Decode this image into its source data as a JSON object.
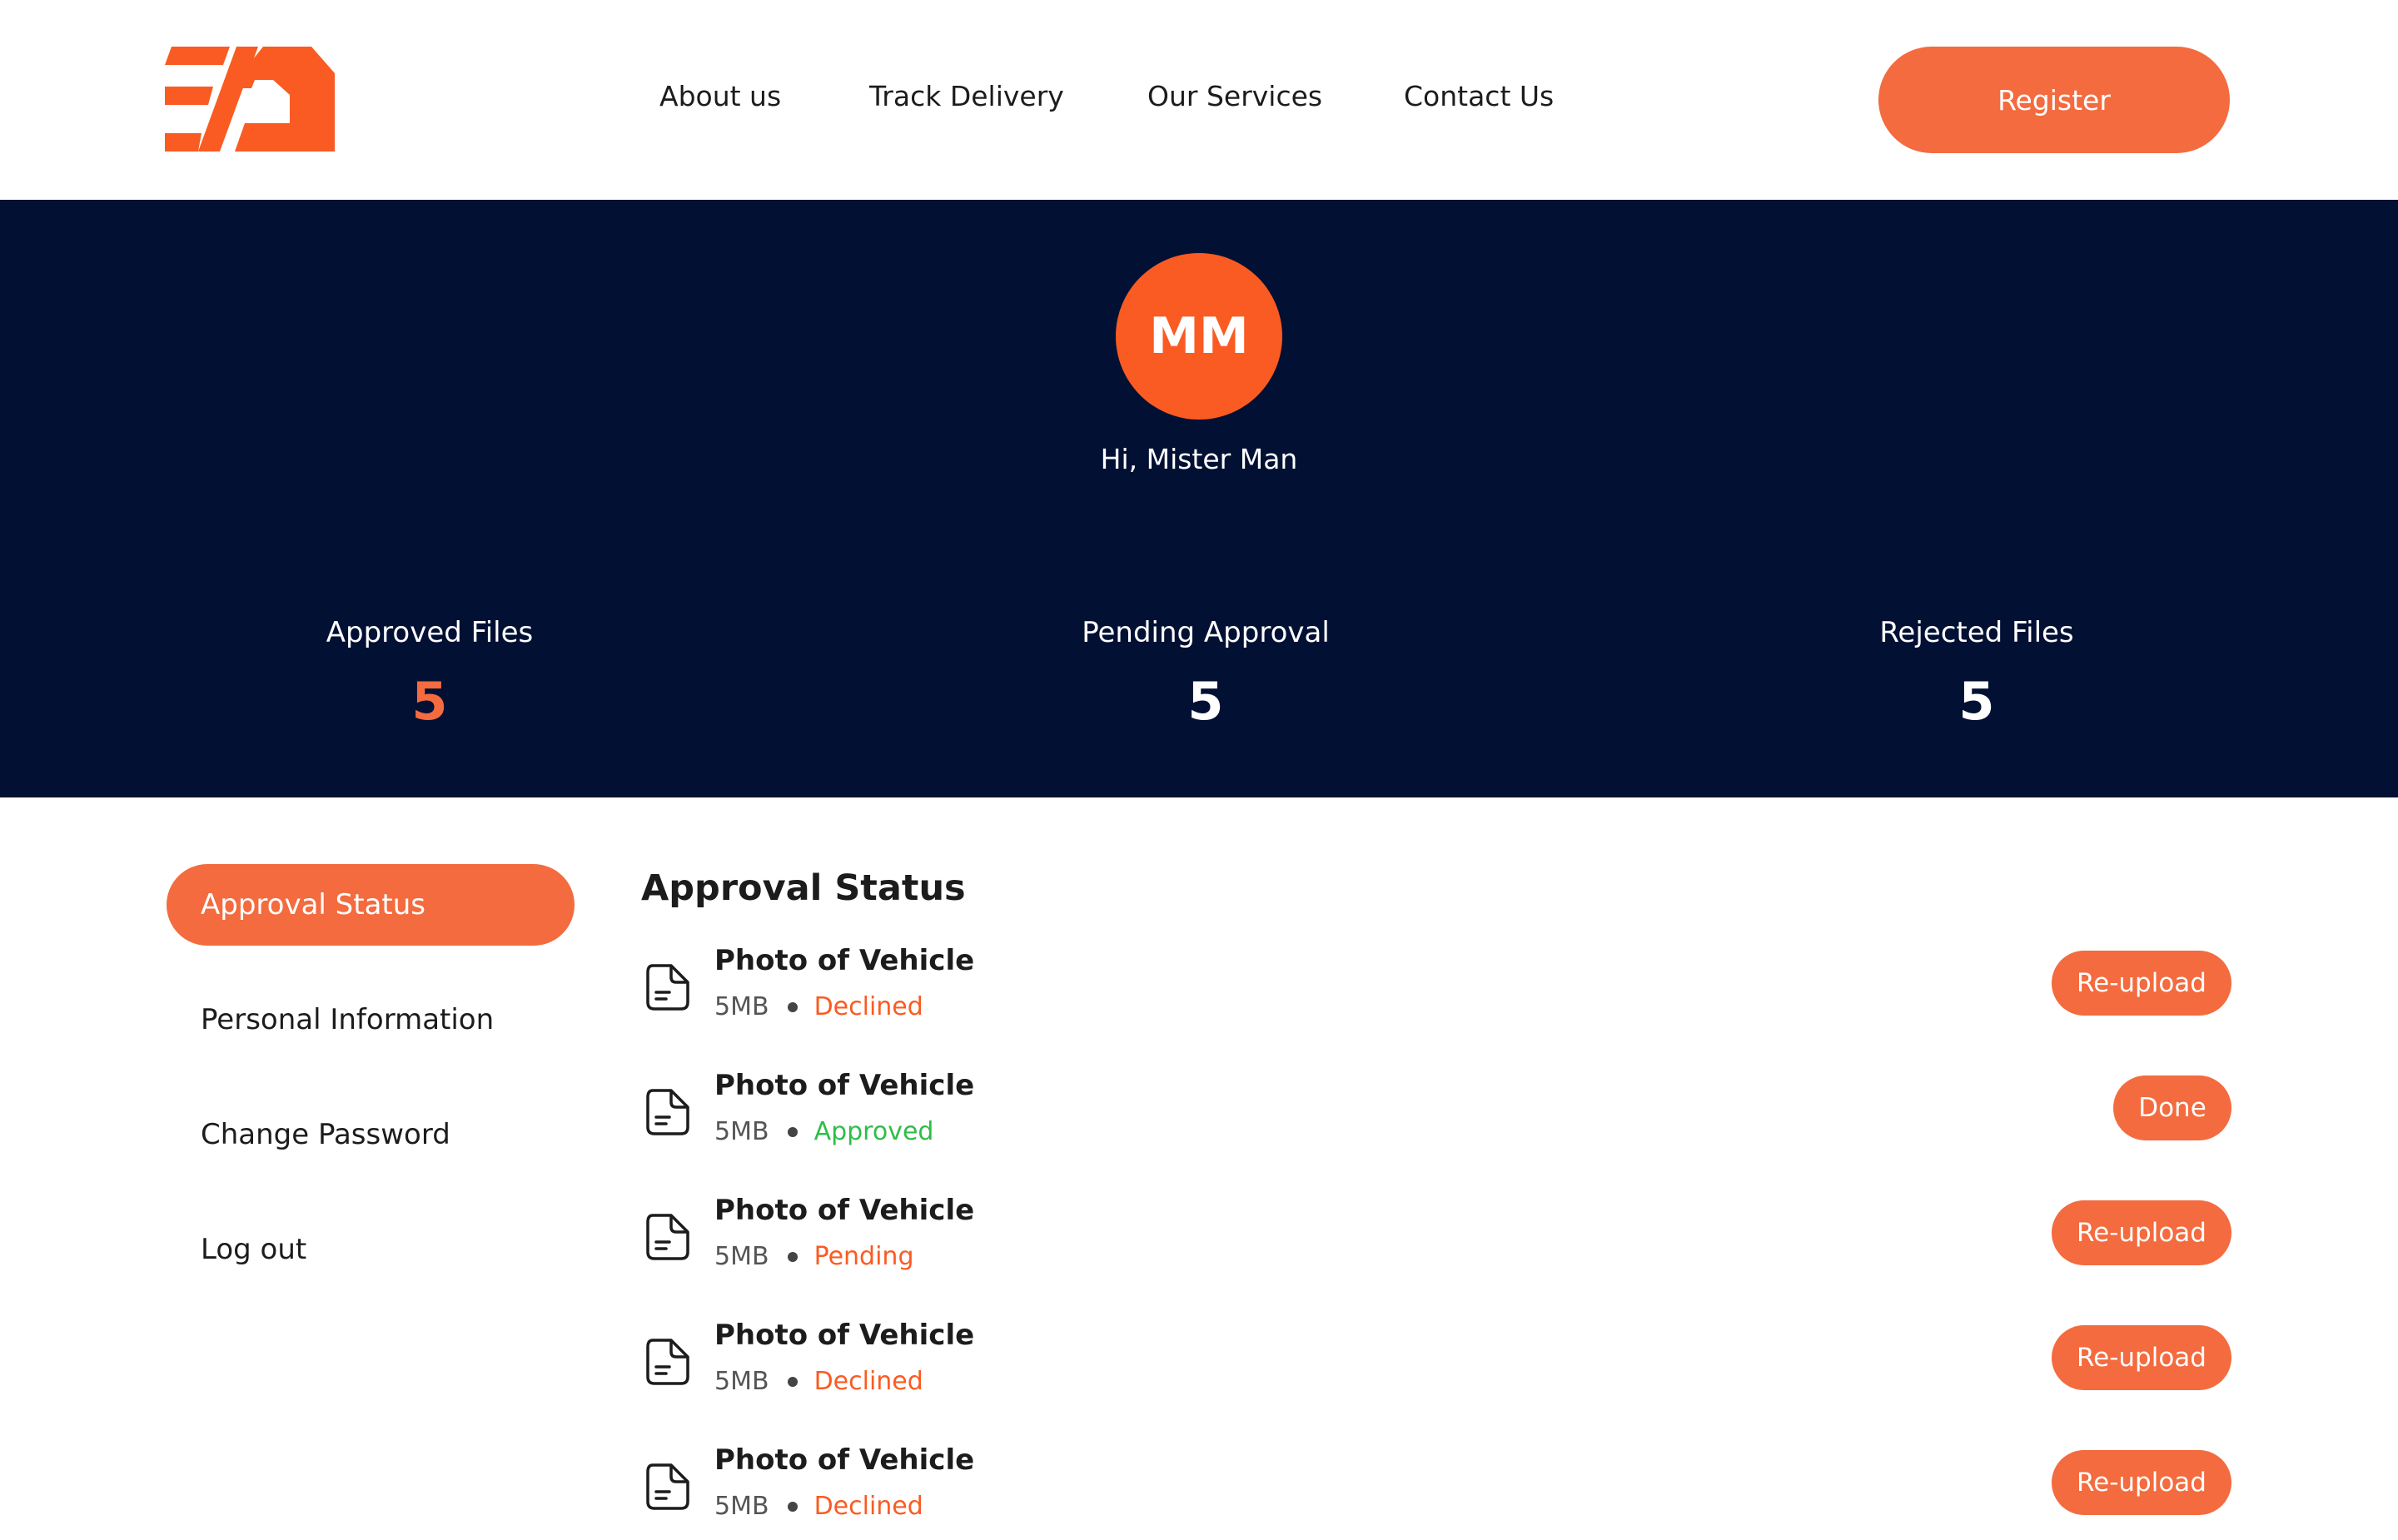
{
  "header": {
    "nav": {
      "about": "About us",
      "track": "Track Delivery",
      "services": "Our Services",
      "contact": "Contact Us"
    },
    "register_label": "Register"
  },
  "profile": {
    "initials": "MM",
    "greeting": "Hi, Mister Man"
  },
  "stats": [
    {
      "label": "Approved Files",
      "value": "5"
    },
    {
      "label": "Pending Approval",
      "value": "5"
    },
    {
      "label": "Rejected Files",
      "value": "5"
    }
  ],
  "sidebar": {
    "items": [
      {
        "label": "Approval Status",
        "active": true
      },
      {
        "label": "Personal Information"
      },
      {
        "label": "Change Password"
      },
      {
        "label": "Log out"
      }
    ]
  },
  "main": {
    "title": "Approval Status",
    "files": [
      {
        "name": "Photo of Vehicle",
        "size": "5MB",
        "status": "Declined",
        "action": "Re-upload"
      },
      {
        "name": "Photo of Vehicle",
        "size": "5MB",
        "status": "Approved",
        "action": "Done"
      },
      {
        "name": "Photo of Vehicle",
        "size": "5MB",
        "status": "Pending",
        "action": "Re-upload"
      },
      {
        "name": "Photo of Vehicle",
        "size": "5MB",
        "status": "Declined",
        "action": "Re-upload"
      },
      {
        "name": "Photo of Vehicle",
        "size": "5MB",
        "status": "Declined",
        "action": "Re-upload"
      }
    ]
  },
  "colors": {
    "brand_orange": "#f36b3e",
    "hero_navy": "#021033",
    "declined": "#fa5b22",
    "approved": "#2fbd4a"
  },
  "icons": {
    "logo": "brand-logo",
    "file": "document-icon"
  }
}
